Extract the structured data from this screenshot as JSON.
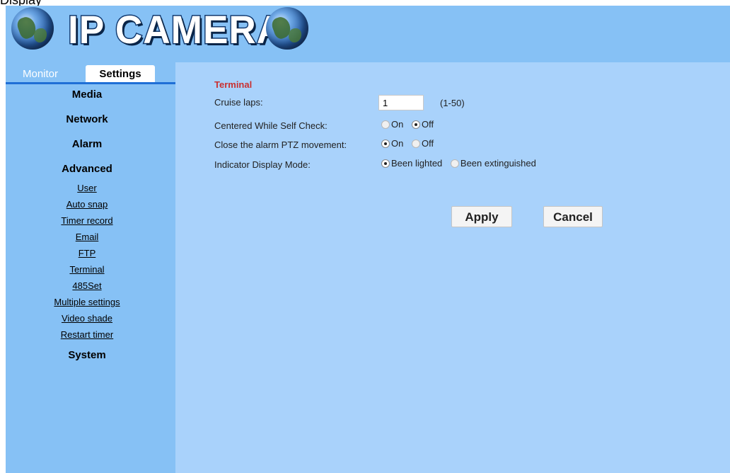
{
  "top_fragment": "Display",
  "header": {
    "logo_text": "IP CAMERA",
    "logo_icon": "globe-icon"
  },
  "tabs": {
    "monitor": "Monitor",
    "settings": "Settings"
  },
  "sidebar": {
    "sections": {
      "media": "Media",
      "network": "Network",
      "alarm": "Alarm",
      "advanced": "Advanced",
      "system": "System"
    },
    "advanced_links": [
      "User",
      "Auto snap",
      "Timer record",
      "Email",
      "FTP",
      "Terminal",
      "485Set",
      "Multiple settings",
      "Video shade",
      "Restart timer"
    ]
  },
  "terminal": {
    "title": "Terminal",
    "cruise_laps": {
      "label": "Cruise laps:",
      "value": "1",
      "range": "(1-50)"
    },
    "centered_self_check": {
      "label": "Centered While Self Check:",
      "options": [
        "On",
        "Off"
      ],
      "selected": "Off"
    },
    "close_alarm_ptz": {
      "label": "Close the alarm PTZ movement:",
      "options": [
        "On",
        "Off"
      ],
      "selected": "On"
    },
    "indicator_mode": {
      "label": "Indicator Display Mode:",
      "options": [
        "Been lighted",
        "Been extinguished"
      ],
      "selected": "Been lighted"
    },
    "apply_label": "Apply",
    "cancel_label": "Cancel"
  },
  "colors": {
    "header_bg": "#86c1f5",
    "sidebar_bg": "#86c1f5",
    "content_bg": "#a9d2fb",
    "title_red": "#c93030"
  }
}
